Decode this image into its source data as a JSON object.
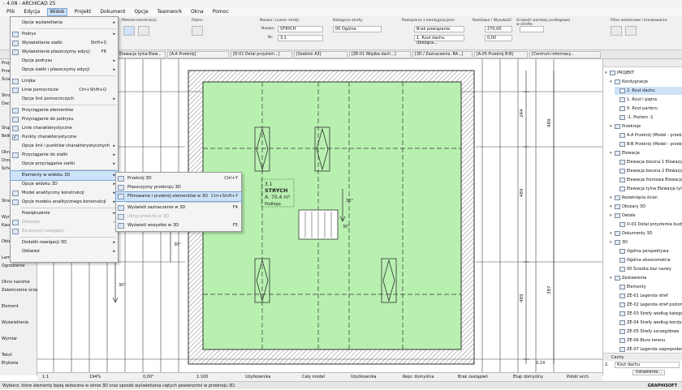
{
  "window": {
    "title": "- 4.08 - ARCHICAD 25"
  },
  "menubar": [
    "Plik",
    "Edycja",
    "Widok",
    "Projekt",
    "Dokument",
    "Opcje",
    "Teamwork",
    "Okna",
    "Pomoc"
  ],
  "menubar_active_index": 2,
  "infobox": {
    "method_label": "Metoda konstrukcji:",
    "floor_label": "Piętro:",
    "name_label": "Nazwa i numer strefy:",
    "name_field_label": "Nazwa:",
    "name_value": "STRYCH",
    "number_field_label": "Nr:",
    "number_value": "3.1",
    "category_label": "Kategoria strefy:",
    "category_value": "00 Ogólne",
    "linking_label": "Powiązanie z kondygnacjami:",
    "linking_top": "Brak powiązania",
    "linking_bottom": "1. Rzut dachu (bieżąca...",
    "height_label": "Rozstawa / Wysokość:",
    "height_top": "270,00",
    "height_bottom": "0,00",
    "relative_label": "Grubość warstwy podłogowej w strefie:",
    "pen_label": "Pióro wektorowe i kreskowanie:"
  },
  "tabs": [
    "Elewacja tylna Elew...",
    "[A-A Przekrój]",
    "[D-01 Detal przyziem...]",
    "[Szablon A3]",
    "[ZE-01 Więźba dach...]",
    "[3D / Zaznaczenie, RA...]",
    "[A-05 Przekrój B-B]",
    "[Centrum informacy..."
  ],
  "toolbox": [
    "Projekt",
    "Przebudowa",
    "Ściana",
    "",
    "Stropy",
    "Dach",
    "",
    "",
    "Słup",
    "Belka",
    "",
    "Okno",
    "Drzwi",
    "Schody",
    "",
    "",
    "",
    "Strefa",
    "",
    "Wymiarowanie",
    "Kaseta",
    "",
    "Obiekt",
    "",
    "Lampa",
    "Ogrodzenie",
    "",
    "Okno narożne",
    "Zakończenie ściany",
    "",
    "Element",
    "",
    "Wyświetlanie",
    "",
    "Wymiar",
    "",
    "Tekst",
    "Etykieta"
  ],
  "view_menu": {
    "items": [
      {
        "label": "Opcje wyświetlania",
        "shortcut": "",
        "submenu": true,
        "icon": false,
        "checked": false,
        "disabled": false
      },
      {
        "label": "Podrys",
        "shortcut": "",
        "submenu": true,
        "icon": true,
        "checked": false,
        "disabled": false
      },
      {
        "label": "Wyświetlanie siatki",
        "shortcut": "Shift+S",
        "submenu": false,
        "icon": true,
        "checked": false,
        "disabled": false
      },
      {
        "label": "Wyświetlanie płaszczyzny edycji",
        "shortcut": "F8",
        "submenu": false,
        "icon": true,
        "checked": false,
        "disabled": false
      },
      {
        "label": "Opcje podrysu",
        "shortcut": "",
        "submenu": true,
        "icon": false,
        "checked": false,
        "disabled": false
      },
      {
        "label": "Opcje siatki i płaszczyzny edycji",
        "shortcut": "",
        "submenu": true,
        "icon": false,
        "checked": false,
        "disabled": false
      },
      {
        "label": "Linijka",
        "shortcut": "",
        "submenu": false,
        "icon": true,
        "checked": false,
        "disabled": false
      },
      {
        "label": "Linie pomocnicze",
        "shortcut": "Ctrl+Shift+Q",
        "submenu": false,
        "icon": true,
        "checked": false,
        "disabled": false
      },
      {
        "label": "Opcje linii pomocniczych",
        "shortcut": "",
        "submenu": true,
        "icon": false,
        "checked": false,
        "disabled": false
      },
      {
        "label": "Przyciąganie elementów",
        "shortcut": "",
        "submenu": false,
        "icon": true,
        "checked": false,
        "disabled": false
      },
      {
        "label": "Przyciąganie do podrysu",
        "shortcut": "",
        "submenu": false,
        "icon": true,
        "checked": false,
        "disabled": false
      },
      {
        "label": "Linie charakterystyczne",
        "shortcut": "",
        "submenu": false,
        "icon": true,
        "checked": false,
        "disabled": false
      },
      {
        "label": "Punkty charakterystyczne",
        "shortcut": "",
        "submenu": false,
        "icon": true,
        "checked": true,
        "disabled": false
      },
      {
        "label": "Opcje linii i punktów charakterystycznych",
        "shortcut": "",
        "submenu": true,
        "icon": false,
        "checked": false,
        "disabled": false
      },
      {
        "label": "Przyciąganie do siatki",
        "shortcut": "",
        "submenu": true,
        "icon": true,
        "checked": false,
        "disabled": false
      },
      {
        "label": "Opcje przyciągania siatki",
        "shortcut": "",
        "submenu": true,
        "icon": false,
        "checked": false,
        "disabled": false
      },
      {
        "label": "Elementy w widoku 3D",
        "shortcut": "",
        "submenu": true,
        "icon": false,
        "checked": false,
        "disabled": false
      },
      {
        "label": "Opcje widoku 3D",
        "shortcut": "",
        "submenu": true,
        "icon": false,
        "checked": false,
        "disabled": false
      },
      {
        "label": "Model analityczny konstrukcji",
        "shortcut": "",
        "submenu": true,
        "icon": true,
        "checked": false,
        "disabled": false
      },
      {
        "label": "Opcje modelu analitycznego konstrukcji",
        "shortcut": "",
        "submenu": true,
        "icon": true,
        "checked": false,
        "disabled": false
      },
      {
        "label": "Powiększenie",
        "shortcut": "",
        "submenu": true,
        "icon": false,
        "checked": false,
        "disabled": false
      },
      {
        "label": "Odśwież",
        "shortcut": "",
        "submenu": true,
        "icon": true,
        "checked": false,
        "disabled": true
      },
      {
        "label": "Ex.pozycji nawigacji",
        "shortcut": "",
        "submenu": false,
        "icon": true,
        "checked": false,
        "disabled": true
      },
      {
        "label": "Dodatki nawigacji 3D",
        "shortcut": "",
        "submenu": true,
        "icon": false,
        "checked": false,
        "disabled": false
      },
      {
        "label": "Odśwież",
        "shortcut": "",
        "submenu": true,
        "icon": false,
        "checked": false,
        "disabled": false
      }
    ]
  },
  "submenu_3d": {
    "items": [
      {
        "label": "Przekrój 3D",
        "shortcut": "Ctrl+Y",
        "disabled": false,
        "highlight": false
      },
      {
        "label": "Płaszczyzny przekroju 3D",
        "shortcut": "",
        "disabled": false,
        "highlight": false
      },
      {
        "label": "Filtrowanie i przekrój elementów w 3D",
        "shortcut": "Ctrl+Shift+Y",
        "disabled": false,
        "highlight": true
      },
      {
        "label": "Wyświetl zaznaczenie w 3D",
        "shortcut": "F4",
        "disabled": false,
        "highlight": false
      },
      {
        "label": "Ukryj przekrój w 3D",
        "shortcut": "",
        "disabled": true,
        "highlight": false
      },
      {
        "label": "Wyświetl wszystko w 3D",
        "shortcut": "F5",
        "disabled": false,
        "highlight": false
      }
    ]
  },
  "plan": {
    "zone_number": "3.1",
    "zone_name": "STRYCH",
    "zone_area": "A: 70,4 m²",
    "zone_floor": "Podłoga",
    "dims_right": [
      "244",
      "489",
      "489",
      "387",
      "489"
    ],
    "dim_bottom": "0,14",
    "angle_labels": [
      "30°",
      "30°",
      "30°",
      "30°"
    ],
    "zone_fill": "#b8f0b0",
    "wall_color": "#555555",
    "accent": "#2060c0"
  },
  "navigator": {
    "items": [
      {
        "label": "PROJEKT",
        "level": 0,
        "selected": false
      },
      {
        "label": "Kondygnacje",
        "level": 1,
        "selected": false
      },
      {
        "label": "2. Rzut dachu",
        "level": 2,
        "selected": true
      },
      {
        "label": "1. Rzut I piętra",
        "level": 2,
        "selected": false
      },
      {
        "label": "0. Rzut parteru",
        "level": 2,
        "selected": false
      },
      {
        "label": "-1. Poziom -1",
        "level": 2,
        "selected": false
      },
      {
        "label": "Przekroje",
        "level": 1,
        "selected": false
      },
      {
        "label": "A-A Przekrój (Model - przebud",
        "level": 2,
        "selected": false
      },
      {
        "label": "B-B Przekrój (Model - przebud",
        "level": 2,
        "selected": false
      },
      {
        "label": "Elewacje",
        "level": 1,
        "selected": false
      },
      {
        "label": "Elewacja boczna 1 Elewacja b",
        "level": 2,
        "selected": false
      },
      {
        "label": "Elewacja boczna 2 Elewacja b",
        "level": 2,
        "selected": false
      },
      {
        "label": "Elewacja frontowa Elewacja fr",
        "level": 2,
        "selected": false
      },
      {
        "label": "Elewacja tylna Elewacja tylna",
        "level": 2,
        "selected": false
      },
      {
        "label": "Rozwinięcia ścian",
        "level": 1,
        "selected": false
      },
      {
        "label": "Obszary 3D",
        "level": 1,
        "selected": false
      },
      {
        "label": "Detale",
        "level": 1,
        "selected": false
      },
      {
        "label": "D-01 Detal przyziemia budynk",
        "level": 2,
        "selected": false
      },
      {
        "label": "Dokumenty 3D",
        "level": 1,
        "selected": false
      },
      {
        "label": "3D",
        "level": 1,
        "selected": false
      },
      {
        "label": "Ogólna perspektywa",
        "level": 2,
        "selected": false
      },
      {
        "label": "Ogólna aksonometria",
        "level": 2,
        "selected": false
      },
      {
        "label": "00 Ścieżka bez nazwy",
        "level": 2,
        "selected": false
      },
      {
        "label": "Zestawienia",
        "level": 1,
        "selected": false
      },
      {
        "label": "Elementy",
        "level": 2,
        "selected": false
      },
      {
        "label": "ZE-01 Legenda stref",
        "level": 3,
        "selected": false
      },
      {
        "label": "ZE-02 Legenda stref pozioma",
        "level": 3,
        "selected": false
      },
      {
        "label": "ZE-03 Strefy według kategor",
        "level": 3,
        "selected": false
      },
      {
        "label": "ZE-04 Strefy według kondyg",
        "level": 3,
        "selected": false
      },
      {
        "label": "ZE-05 Strefy szczegółowe",
        "level": 3,
        "selected": false
      },
      {
        "label": "ZE-06 Biuro terenu",
        "level": 3,
        "selected": false
      },
      {
        "label": "ZE-07 Legenda zagospodaro",
        "level": 3,
        "selected": false
      }
    ],
    "props_header": "Cechy",
    "props_floor": "2.",
    "props_floor_name": "Rzut dachu",
    "props_settings": "Ustawienia..."
  },
  "viewbar": [
    "1:1",
    "194%",
    "0,00°",
    "1:100",
    "Użytkownika",
    "Cały model",
    "Użytkownika",
    "Repr. domyślna",
    "Brak zastąpień",
    "Etap domyślny",
    "Polski arch."
  ],
  "status": "Wybierz, które elementy będą widoczne w oknie 3D oraz sposób wyświetlania ciętych powierzchni w przekroju 3D.",
  "brand": "GRAPHISOFT"
}
